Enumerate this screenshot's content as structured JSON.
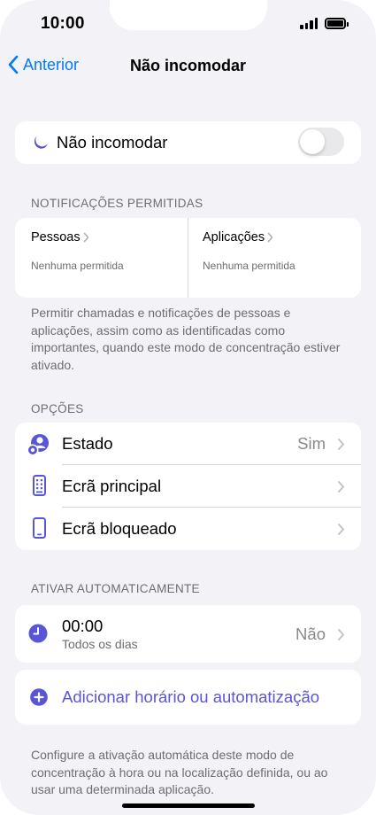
{
  "status_bar": {
    "time": "10:00"
  },
  "nav": {
    "back_label": "Anterior",
    "title": "Não incomodar"
  },
  "focus_toggle": {
    "label": "Não incomodar",
    "enabled": false
  },
  "allowed_notifications": {
    "header": "NOTIFICAÇÕES PERMITIDAS",
    "people": {
      "title": "Pessoas",
      "subtitle": "Nenhuma permitida"
    },
    "apps": {
      "title": "Aplicações",
      "subtitle": "Nenhuma permitida"
    },
    "footnote": "Permitir chamadas e notificações de pessoas e aplicações, assim como as identificadas como importantes, quando este modo de concentração estiver ativado."
  },
  "options": {
    "header": "OPÇÕES",
    "items": [
      {
        "label": "Estado",
        "value": "Sim",
        "icon": "focus-status-icon"
      },
      {
        "label": "Ecrã principal",
        "value": "",
        "icon": "home-screen-icon"
      },
      {
        "label": "Ecrã bloqueado",
        "value": "",
        "icon": "lock-screen-icon"
      }
    ]
  },
  "auto_activation": {
    "header": "ATIVAR AUTOMATICAMENTE",
    "schedule": {
      "time": "00:00",
      "days": "Todos os dias",
      "value": "Não",
      "icon": "clock-icon"
    },
    "add_label": "Adicionar horário ou automatização",
    "footnote": "Configure a ativação automática deste modo de concentração à hora ou na localização definida, ou ao usar uma determinada aplicação."
  },
  "colors": {
    "accent": "#5856d6",
    "link": "#007aff",
    "background": "#f2f2f7"
  }
}
